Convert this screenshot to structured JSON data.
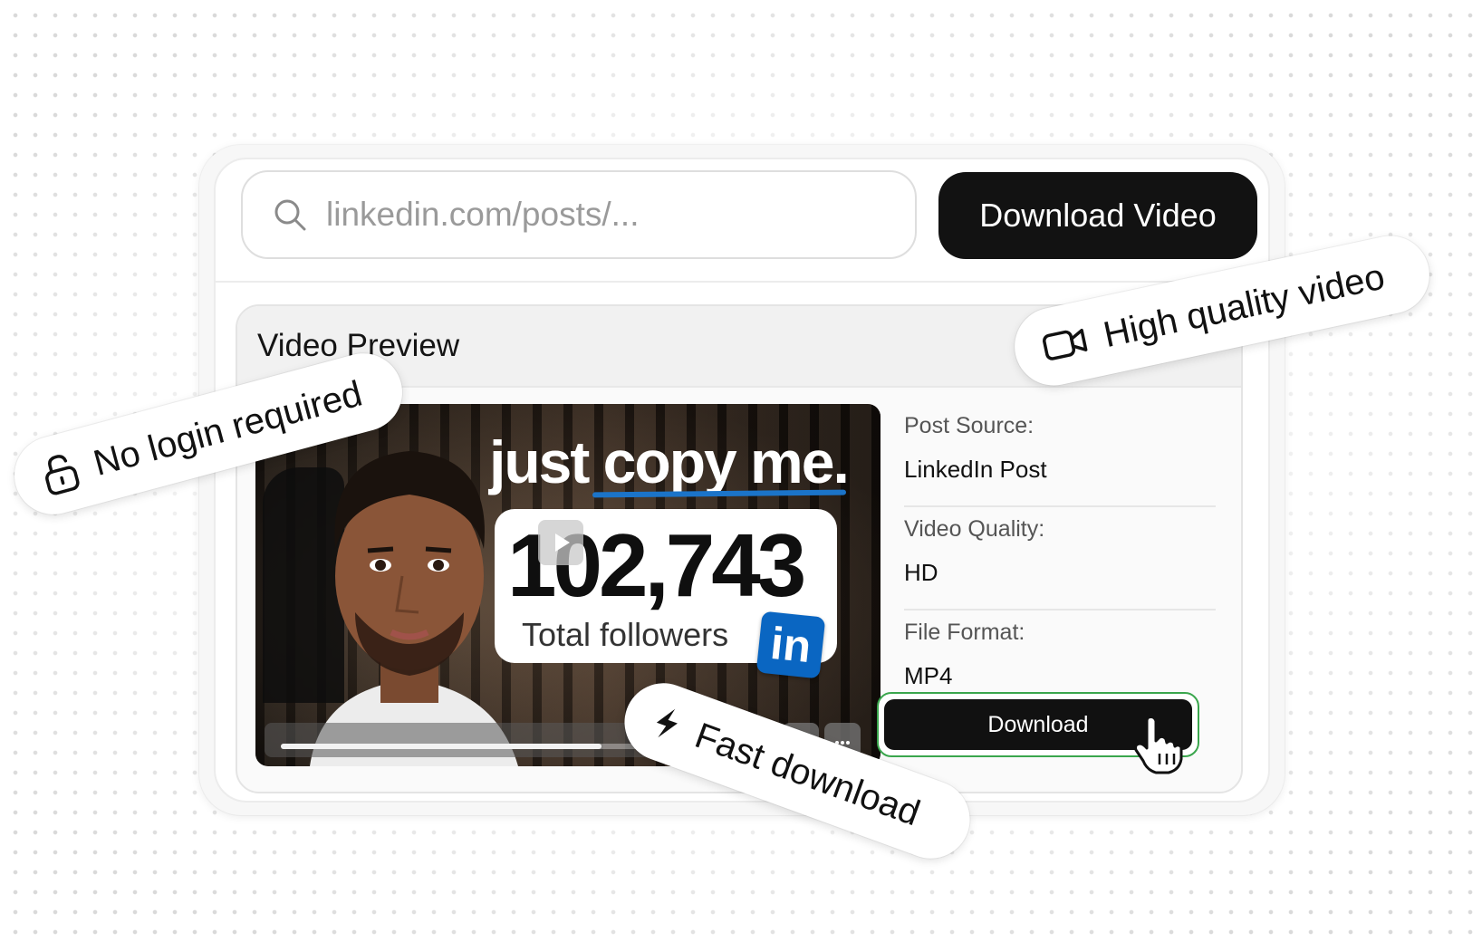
{
  "search": {
    "placeholder": "linkedin.com/posts/..."
  },
  "header": {
    "download_video_label": "Download Video"
  },
  "preview": {
    "title": "Video Preview",
    "thumbnail": {
      "headline": "just copy me.",
      "stat_number": "102,743",
      "stat_label": "Total followers",
      "logo_text": "in",
      "progress": 0.68
    }
  },
  "info": {
    "items": [
      {
        "label": "Post Source:",
        "value": "LinkedIn Post"
      },
      {
        "label": "Video Quality:",
        "value": "HD"
      },
      {
        "label": "File Format:",
        "value": "MP4"
      }
    ],
    "download_label": "Download"
  },
  "badges": {
    "no_login": "No login required",
    "high_quality": "High quality video",
    "fast_download": "Fast download"
  },
  "colors": {
    "accent_dark": "#121212",
    "linkedin_blue": "#0a66c2",
    "download_outline": "#3aa64d"
  },
  "icons": {
    "search": "search-icon",
    "unlock": "unlock-icon",
    "video_camera": "video-camera-icon",
    "lightning": "lightning-icon",
    "pointer_hand": "pointer-hand-icon",
    "volume": "volume-icon",
    "more": "more-icon",
    "play": "play-icon"
  }
}
